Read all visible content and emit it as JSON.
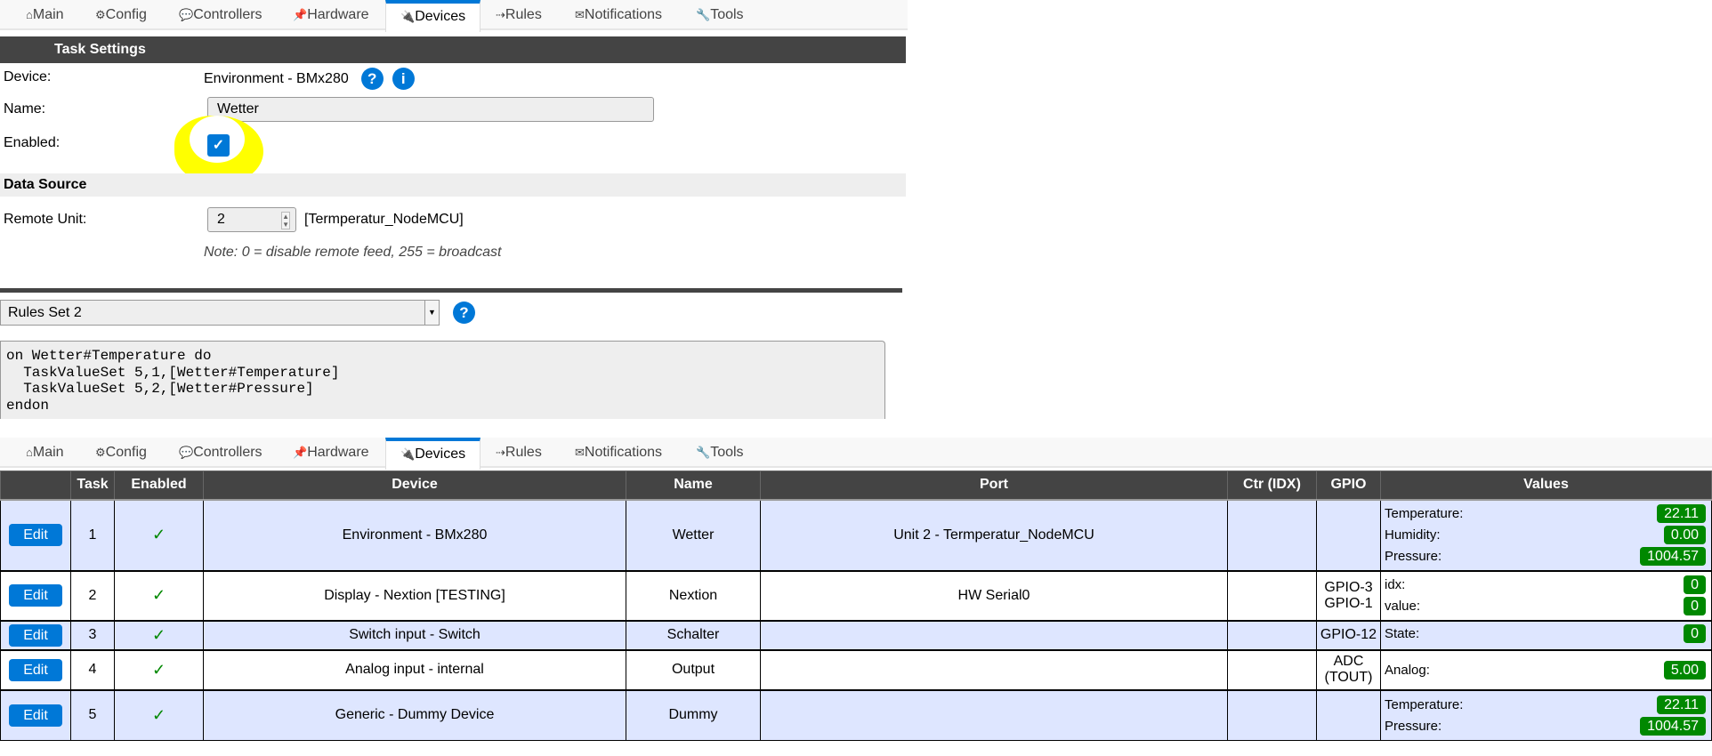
{
  "nav_tabs": [
    {
      "icon": "home-icon",
      "glyph": "⌂",
      "label": "Main"
    },
    {
      "icon": "gear-icon",
      "glyph": "⚙",
      "label": "Config"
    },
    {
      "icon": "speech-bubble-icon",
      "glyph": "💬",
      "label": "Controllers"
    },
    {
      "icon": "pushpin-icon",
      "glyph": "📌",
      "label": "Hardware"
    },
    {
      "icon": "plug-icon",
      "glyph": "🔌",
      "label": "Devices",
      "active": true
    },
    {
      "icon": "arrow-icon",
      "glyph": "⇢",
      "label": "Rules"
    },
    {
      "icon": "envelope-icon",
      "glyph": "✉",
      "label": "Notifications"
    },
    {
      "icon": "wrench-icon",
      "glyph": "🔧",
      "label": "Tools"
    }
  ],
  "task_settings": {
    "title": "Task Settings",
    "device_label": "Device:",
    "device_value": "Environment - BMx280",
    "name_label": "Name:",
    "name_value": "Wetter",
    "enabled_label": "Enabled:",
    "enabled": true,
    "highlight_color": "#ffff00"
  },
  "data_source": {
    "title": "Data Source",
    "remote_unit_label": "Remote Unit:",
    "remote_unit_value": "2",
    "remote_unit_name": "[Termperatur_NodeMCU]",
    "note": "Note: 0 = disable remote feed, 255 = broadcast"
  },
  "rules": {
    "selected_set": "Rules Set 2",
    "code": "on Wetter#Temperature do\n  TaskValueSet 5,1,[Wetter#Temperature]\n  TaskValueSet 5,2,[Wetter#Pressure]\nendon"
  },
  "devices_table": {
    "headers": [
      "",
      "Task",
      "Enabled",
      "Device",
      "Name",
      "Port",
      "Ctr (IDX)",
      "GPIO",
      "Values"
    ],
    "edit_label": "Edit",
    "enabled_glyph": "✓",
    "rows": [
      {
        "task": "1",
        "device": "Environment - BMx280",
        "name": "Wetter",
        "port": "Unit 2 - Termperatur_NodeMCU",
        "ctr": "",
        "gpio": [],
        "values": [
          {
            "label": "Temperature:",
            "value": "22.11"
          },
          {
            "label": "Humidity:",
            "value": "0.00"
          },
          {
            "label": "Pressure:",
            "value": "1004.57"
          }
        ]
      },
      {
        "task": "2",
        "device": "Display - Nextion [TESTING]",
        "name": "Nextion",
        "port": "HW Serial0",
        "ctr": "",
        "gpio": [
          "GPIO-3",
          "GPIO-1"
        ],
        "values": [
          {
            "label": "idx:",
            "value": "0"
          },
          {
            "label": "value:",
            "value": "0"
          }
        ]
      },
      {
        "task": "3",
        "device": "Switch input - Switch",
        "name": "Schalter",
        "port": "",
        "ctr": "",
        "gpio": [
          "GPIO-12"
        ],
        "values": [
          {
            "label": "State:",
            "value": "0"
          }
        ]
      },
      {
        "task": "4",
        "device": "Analog input - internal",
        "name": "Output",
        "port": "",
        "ctr": "",
        "gpio": [
          "ADC",
          "(TOUT)"
        ],
        "values": [
          {
            "label": "Analog:",
            "value": "5.00"
          }
        ]
      },
      {
        "task": "5",
        "device": "Generic - Dummy Device",
        "name": "Dummy",
        "port": "",
        "ctr": "",
        "gpio": [],
        "values": [
          {
            "label": "Temperature:",
            "value": "22.11"
          },
          {
            "label": "Pressure:",
            "value": "1004.57"
          }
        ]
      }
    ]
  },
  "colors": {
    "accent": "#0078d7",
    "header_bg": "#444444",
    "row_alt": "#dee6ff",
    "value_badge": "#008800"
  }
}
